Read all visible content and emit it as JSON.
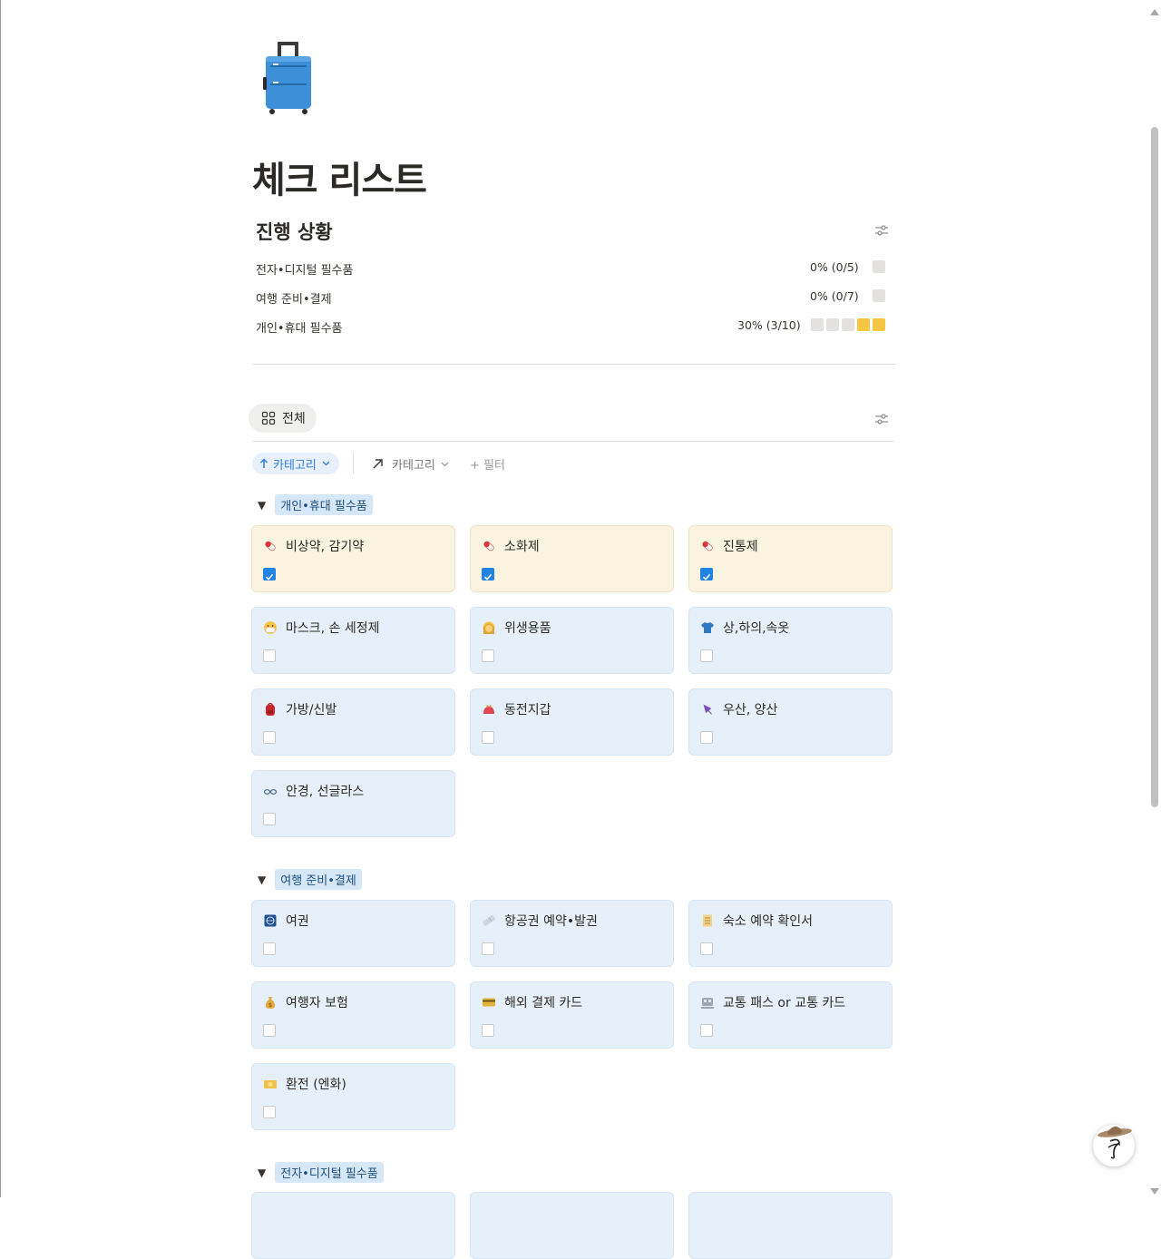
{
  "page": {
    "title": "체크 리스트",
    "icon": "luggage-icon"
  },
  "progress": {
    "heading": "진행 상황",
    "rows": [
      {
        "label": "전자•디지털 필수품",
        "percent_text": "0% (0/5)",
        "done": 0,
        "total": 5
      },
      {
        "label": "여행 준비•결제",
        "percent_text": "0% (0/7)",
        "done": 0,
        "total": 7
      },
      {
        "label": "개인•휴대 필수품",
        "percent_text": "30% (3/10)",
        "done": 3,
        "total": 10
      }
    ]
  },
  "view": {
    "tab_label": "전체",
    "sort_label": "카테고리",
    "group_label": "카테고리",
    "filter_label": "+ 필터"
  },
  "groups": [
    {
      "name": "개인•휴대 필수품",
      "items": [
        {
          "title": "비상약, 감기약",
          "icon": "pill-icon",
          "checked": true
        },
        {
          "title": "소화제",
          "icon": "pill-icon",
          "checked": true
        },
        {
          "title": "진통제",
          "icon": "pill-icon",
          "checked": true
        },
        {
          "title": "마스크, 손 세정제",
          "icon": "mask-face-icon",
          "checked": false
        },
        {
          "title": "위생용품",
          "icon": "person-icon",
          "checked": false
        },
        {
          "title": "상,하의,속옷",
          "icon": "tshirt-icon",
          "checked": false
        },
        {
          "title": "가방/신발",
          "icon": "backpack-icon",
          "checked": false
        },
        {
          "title": "동전지갑",
          "icon": "purse-icon",
          "checked": false
        },
        {
          "title": "우산, 양산",
          "icon": "umbrella-icon",
          "checked": false
        },
        {
          "title": "안경, 선글라스",
          "icon": "glasses-icon",
          "checked": false
        }
      ]
    },
    {
      "name": "여행 준비•결제",
      "items": [
        {
          "title": "여권",
          "icon": "passport-icon",
          "checked": false
        },
        {
          "title": "항공권 예약•발권",
          "icon": "ticket-icon",
          "checked": false
        },
        {
          "title": "숙소 예약 확인서",
          "icon": "receipt-icon",
          "checked": false
        },
        {
          "title": "여행자 보험",
          "icon": "money-bag-icon",
          "checked": false
        },
        {
          "title": "해외 결제 카드",
          "icon": "credit-card-icon",
          "checked": false
        },
        {
          "title": "교통 패스 or 교통 카드",
          "icon": "train-icon",
          "checked": false
        },
        {
          "title": "환전 (엔화)",
          "icon": "yen-banknote-icon",
          "checked": false
        }
      ]
    },
    {
      "name": "전자•디지털 필수품",
      "items": []
    }
  ],
  "colors": {
    "accent": "#2383e2",
    "card_blue": "#e6f0fa",
    "card_yellow": "#f9f3df",
    "progress_fill": "#f6c544"
  }
}
